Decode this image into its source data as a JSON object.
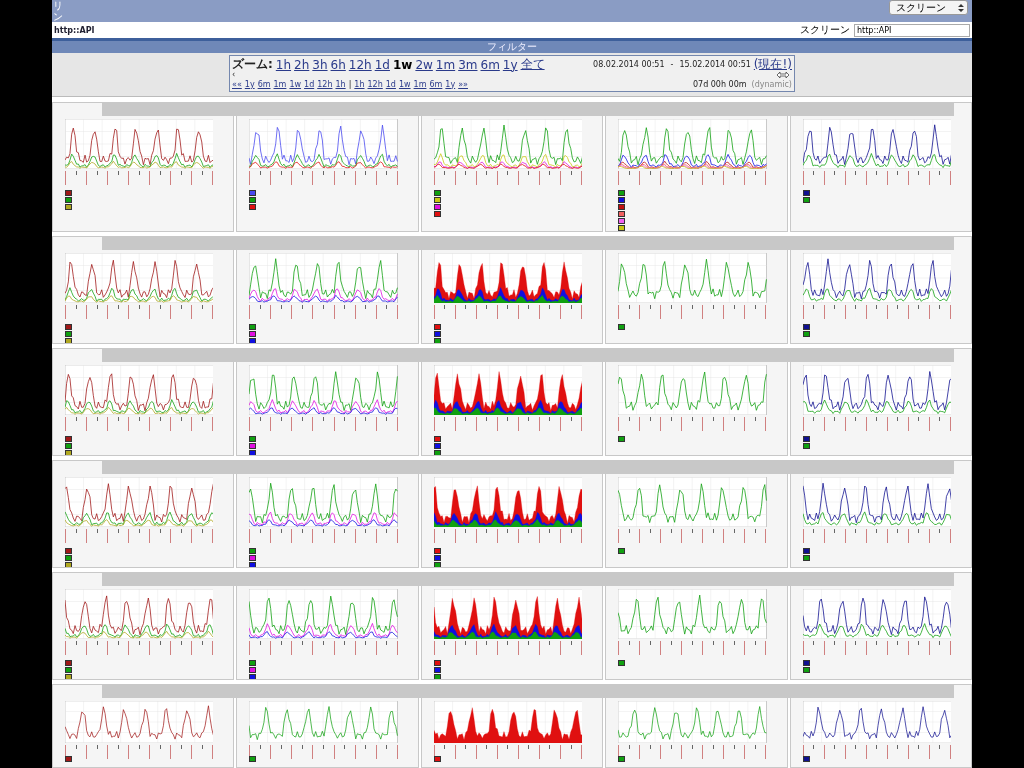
{
  "header": {
    "title": "リン",
    "select": "スクリーン"
  },
  "screen_bar": {
    "name": "http::API",
    "label": "スクリーン",
    "value": "http::API"
  },
  "filter": {
    "label": "フィルター"
  },
  "nav": {
    "zoom_label": "ズーム:",
    "zoom_links": [
      {
        "label": "1h",
        "selected": false
      },
      {
        "label": "2h",
        "selected": false
      },
      {
        "label": "3h",
        "selected": false
      },
      {
        "label": "6h",
        "selected": false
      },
      {
        "label": "12h",
        "selected": false
      },
      {
        "label": "1d",
        "selected": false
      },
      {
        "label": "1w",
        "selected": true
      },
      {
        "label": "2w",
        "selected": false
      },
      {
        "label": "1m",
        "selected": false
      },
      {
        "label": "3m",
        "selected": false
      },
      {
        "label": "6m",
        "selected": false
      },
      {
        "label": "1y",
        "selected": false
      },
      {
        "label": "全て",
        "selected": false
      }
    ],
    "from": "08.02.2014 00:51",
    "dash": "-",
    "to": "15.02.2014 00:51",
    "now": "(現在!)",
    "scroll_left": "‹",
    "back_links": [
      "««",
      "1y",
      "6m",
      "1m",
      "1w",
      "1d",
      "12h",
      "1h"
    ],
    "separator": "|",
    "fwd_links": [
      "1h",
      "12h",
      "1d",
      "1w",
      "1m",
      "6m",
      "1y",
      "»»"
    ],
    "period": "07d 00h 00m",
    "mode": "(dynamic)"
  },
  "rows": [
    {
      "graphs": [
        {
          "kind": "line",
          "lines": [
            {
              "color": "#a01818"
            },
            {
              "color": "#10a010"
            },
            {
              "color": "#b0a820"
            }
          ]
        },
        {
          "kind": "line",
          "lines": [
            {
              "color": "#4848f0"
            },
            {
              "color": "#10a010"
            },
            {
              "color": "#e01010"
            }
          ]
        },
        {
          "kind": "line",
          "lines": [
            {
              "color": "#10a010"
            },
            {
              "color": "#c8c810"
            },
            {
              "color": "#e010e0"
            },
            {
              "color": "#e01010"
            }
          ]
        },
        {
          "kind": "line",
          "lines": [
            {
              "color": "#10a010"
            },
            {
              "color": "#1010e0"
            },
            {
              "color": "#c01010"
            },
            {
              "color": "#f06060"
            },
            {
              "color": "#f060f0"
            },
            {
              "color": "#c8c810"
            }
          ]
        },
        {
          "kind": "line",
          "lines": [
            {
              "color": "#101090"
            },
            {
              "color": "#10a010"
            }
          ]
        }
      ]
    },
    {
      "graphs": [
        {
          "kind": "line",
          "lines": [
            {
              "color": "#a01818"
            },
            {
              "color": "#10a010"
            },
            {
              "color": "#b0a820"
            }
          ]
        },
        {
          "kind": "line",
          "lines": [
            {
              "color": "#10a010"
            },
            {
              "color": "#e010e0"
            },
            {
              "color": "#1010e0"
            }
          ]
        },
        {
          "kind": "area",
          "lines": [
            {
              "color": "#e01010"
            },
            {
              "color": "#1010e0"
            },
            {
              "color": "#10a010"
            }
          ]
        },
        {
          "kind": "line",
          "lines": [
            {
              "color": "#10a010"
            }
          ]
        },
        {
          "kind": "line",
          "lines": [
            {
              "color": "#101090"
            },
            {
              "color": "#10a010"
            }
          ]
        }
      ]
    },
    {
      "graphs": [
        {
          "kind": "line",
          "lines": [
            {
              "color": "#a01818"
            },
            {
              "color": "#10a010"
            },
            {
              "color": "#b0a820"
            }
          ]
        },
        {
          "kind": "line",
          "lines": [
            {
              "color": "#10a010"
            },
            {
              "color": "#e010e0"
            },
            {
              "color": "#1010e0"
            }
          ]
        },
        {
          "kind": "area",
          "lines": [
            {
              "color": "#e01010"
            },
            {
              "color": "#1010e0"
            },
            {
              "color": "#10a010"
            }
          ]
        },
        {
          "kind": "line",
          "lines": [
            {
              "color": "#10a010"
            }
          ]
        },
        {
          "kind": "line",
          "lines": [
            {
              "color": "#101090"
            },
            {
              "color": "#10a010"
            }
          ]
        }
      ]
    },
    {
      "graphs": [
        {
          "kind": "line",
          "lines": [
            {
              "color": "#a01818"
            },
            {
              "color": "#10a010"
            },
            {
              "color": "#b0a820"
            }
          ]
        },
        {
          "kind": "line",
          "lines": [
            {
              "color": "#10a010"
            },
            {
              "color": "#e010e0"
            },
            {
              "color": "#1010e0"
            }
          ]
        },
        {
          "kind": "area",
          "lines": [
            {
              "color": "#e01010"
            },
            {
              "color": "#1010e0"
            },
            {
              "color": "#10a010"
            }
          ]
        },
        {
          "kind": "line",
          "lines": [
            {
              "color": "#10a010"
            }
          ]
        },
        {
          "kind": "line",
          "lines": [
            {
              "color": "#101090"
            },
            {
              "color": "#10a010"
            }
          ]
        }
      ]
    },
    {
      "graphs": [
        {
          "kind": "line",
          "lines": [
            {
              "color": "#a01818"
            },
            {
              "color": "#10a010"
            },
            {
              "color": "#b0a820"
            }
          ]
        },
        {
          "kind": "line",
          "lines": [
            {
              "color": "#10a010"
            },
            {
              "color": "#e010e0"
            },
            {
              "color": "#1010e0"
            }
          ]
        },
        {
          "kind": "area",
          "lines": [
            {
              "color": "#e01010"
            },
            {
              "color": "#1010e0"
            },
            {
              "color": "#10a010"
            }
          ]
        },
        {
          "kind": "line",
          "lines": [
            {
              "color": "#10a010"
            }
          ]
        },
        {
          "kind": "line",
          "lines": [
            {
              "color": "#101090"
            },
            {
              "color": "#10a010"
            }
          ]
        }
      ]
    },
    {
      "graphs": [
        {
          "kind": "line",
          "lines": [
            {
              "color": "#a01818"
            }
          ]
        },
        {
          "kind": "line",
          "lines": [
            {
              "color": "#10a010"
            }
          ]
        },
        {
          "kind": "area",
          "lines": [
            {
              "color": "#e01010"
            }
          ]
        },
        {
          "kind": "line",
          "lines": [
            {
              "color": "#10a010"
            }
          ]
        },
        {
          "kind": "line",
          "lines": [
            {
              "color": "#101090"
            }
          ]
        }
      ]
    }
  ]
}
